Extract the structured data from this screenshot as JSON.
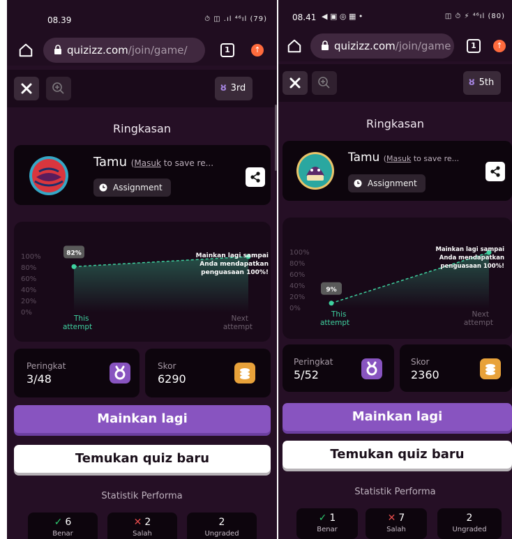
{
  "colors": {
    "accent": "#8854c0",
    "gold": "#e8a23a",
    "correct": "#2ecc71",
    "incorrect": "#e74c4c",
    "chart_line": "#3fd2a0"
  },
  "left": {
    "status": {
      "time": "08.39",
      "icons": "⏱ ◫ .ıl ⁴⁶ıl (79)"
    },
    "url": {
      "domain": "quizizz.com",
      "path": "/join/game/",
      "tab_count": "1"
    },
    "game": {
      "rank_badge": "3rd"
    },
    "summary_title": "Ringkasan",
    "profile": {
      "name": "Tamu",
      "login_prefix": "(",
      "login_link": "Masuk",
      "login_suffix": " to save re...",
      "mode": "Assignment"
    },
    "chart": {
      "y_ticks": [
        "100%",
        "80%",
        "60%",
        "40%",
        "20%",
        "0%"
      ],
      "point_label": "82%",
      "x_labels": [
        "This",
        "attempt",
        "Next",
        "attempt"
      ],
      "note": [
        "Mainkan lagi sampai",
        "Anda mendapatkan",
        "penguasaan 100%!"
      ]
    },
    "chart_data": {
      "type": "line",
      "categories": [
        "This attempt",
        "Next attempt"
      ],
      "values": [
        82,
        100
      ],
      "ylim": [
        0,
        100
      ]
    },
    "rank": {
      "label": "Peringkat",
      "value": "3/48"
    },
    "score": {
      "label": "Skor",
      "value": "6290"
    },
    "play_again": "Mainkan lagi",
    "find_quiz": "Temukan quiz baru",
    "perf_title": "Statistik Performa",
    "perf": [
      {
        "symbol": "✓",
        "value": "6",
        "label": "Benar"
      },
      {
        "symbol": "✕",
        "value": "2",
        "label": "Salah"
      },
      {
        "value": "2",
        "label": "Ungraded"
      }
    ]
  },
  "right": {
    "status": {
      "time": "08.41",
      "icons": "◫ ⏱ ⚡ ⁴⁶ıl (80)"
    },
    "url": {
      "domain": "quizizz.com",
      "path": "/join/game",
      "tab_count": "1"
    },
    "game": {
      "rank_badge": "5th"
    },
    "summary_title": "Ringkasan",
    "profile": {
      "name": "Tamu",
      "login_prefix": "(",
      "login_link": "Masuk",
      "login_suffix": " to save re...",
      "mode": "Assignment"
    },
    "chart": {
      "y_ticks": [
        "100%",
        "80%",
        "60%",
        "40%",
        "20%",
        "0%"
      ],
      "point_label": "9%",
      "x_labels": [
        "This",
        "attempt",
        "Next",
        "attempt"
      ],
      "note": [
        "Mainkan lagi sampai",
        "Anda mendapatkan",
        "penguasaan 100%!"
      ]
    },
    "chart_data": {
      "type": "line",
      "categories": [
        "This attempt",
        "Next attempt"
      ],
      "values": [
        9,
        100
      ],
      "ylim": [
        0,
        100
      ]
    },
    "rank": {
      "label": "Peringkat",
      "value": "5/52"
    },
    "score": {
      "label": "Skor",
      "value": "2360"
    },
    "play_again": "Mainkan lagi",
    "find_quiz": "Temukan quiz baru",
    "perf_title": "Statistik Performa",
    "perf": [
      {
        "symbol": "✓",
        "value": "1",
        "label": "Benar"
      },
      {
        "symbol": "✕",
        "value": "7",
        "label": "Salah"
      },
      {
        "value": "2",
        "label": "Ungraded"
      }
    ]
  }
}
